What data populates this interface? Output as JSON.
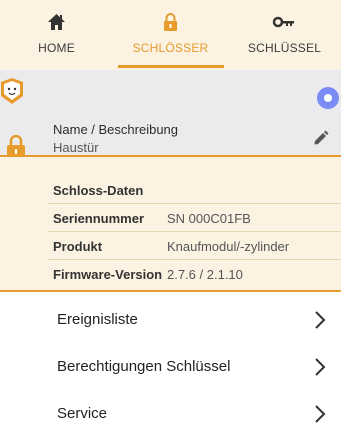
{
  "tabs": {
    "home": {
      "label": "HOME",
      "icon": "home-icon"
    },
    "schloesser": {
      "label": "SCHLÖSSER",
      "icon": "lock-icon"
    },
    "schluessel": {
      "label": "SCHLÜSSEL",
      "icon": "key-icon"
    }
  },
  "lock": {
    "name_label": "Name / Beschreibung",
    "name_value": "Haustür"
  },
  "schloss_daten": {
    "header": "Schloss-Daten",
    "rows": [
      {
        "label": "Seriennummer",
        "value": "SN 000C01FB"
      },
      {
        "label": "Produkt",
        "value": "Knaufmodul/-zylinder"
      },
      {
        "label": "Firmware-Version",
        "value": "2.7.6 / 2.1.10"
      }
    ]
  },
  "menu": [
    {
      "label": "Ereignisliste"
    },
    {
      "label": "Berechtigungen Schlüssel"
    },
    {
      "label": "Service"
    }
  ],
  "colors": {
    "accent": "#e79b2c",
    "status_dot": "#7a8cf5",
    "header_bg": "#fbf2e2",
    "card_bg": "#ebebee"
  }
}
